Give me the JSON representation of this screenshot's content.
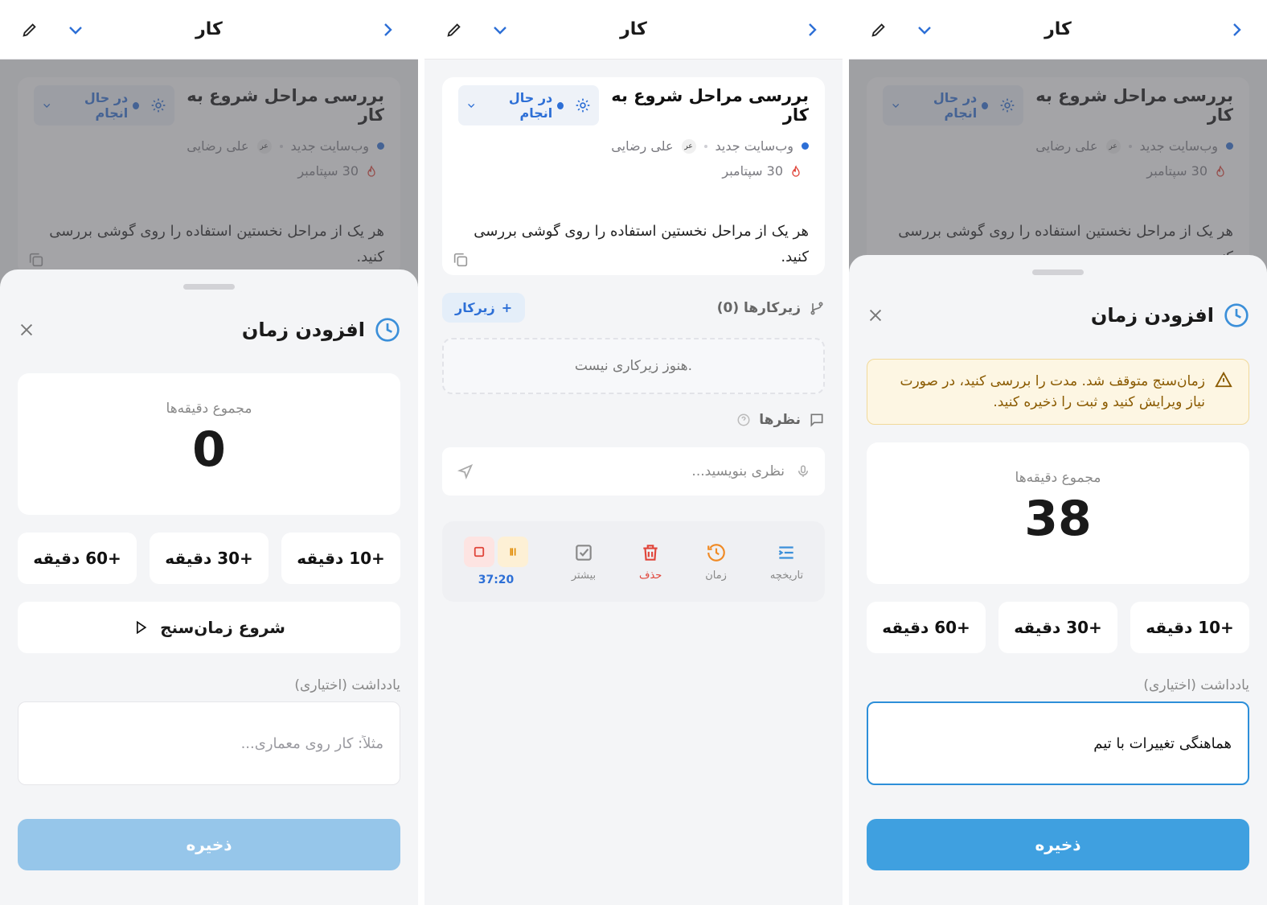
{
  "header": {
    "title": "کار"
  },
  "task": {
    "title": "بررسی مراحل شروع به کار",
    "status": "در حال انجام",
    "project": "وب‌سایت جدید",
    "assignee": "علی رضایی",
    "assignee_initials": "عر",
    "due": "30 سپتامبر",
    "description": "هر یک از مراحل نخستین استفاده را روی گوشی بررسی کنید."
  },
  "sheet": {
    "title": "افزودن زمان",
    "total_label": "مجموع دقیقه‌ها",
    "quick": [
      "+10 دقیقه",
      "+30 دقیقه",
      "+60 دقیقه"
    ],
    "start_timer": "شروع زمان‌سنج",
    "note_label": "یادداشت (اختیاری)",
    "note_placeholder": "مثلاً: کار روی معماری...",
    "save": "ذخیره"
  },
  "panel1": {
    "total": "0"
  },
  "panel3": {
    "total": "38",
    "note_value": "هماهنگی تغییرات با تیم",
    "warning": "زمان‌سنج متوقف شد. مدت را بررسی کنید، در صورت نیاز ویرایش کنید و ثبت را ذخیره کنید."
  },
  "panel2": {
    "subtasks_label": "زیرکارها (0)",
    "add_subtask": "زیرکار",
    "no_subtasks": "هنوز زیرکاری نیست.",
    "comments_label": "نظرها",
    "comment_placeholder": "نظری بنویسید...",
    "actions": [
      {
        "label": "تاریخچه",
        "icon": "history-list-icon",
        "color": "#3b8fd9"
      },
      {
        "label": "زمان",
        "icon": "clock-rewind-icon",
        "color": "#f08a24"
      },
      {
        "label": "حذف",
        "icon": "trash-icon",
        "color": "#e0453a"
      },
      {
        "label": "بیشتر",
        "icon": "checkbox-icon",
        "color": "#888888"
      }
    ],
    "timer": "37:20"
  },
  "colors": {
    "accent": "#2d6fd6",
    "save_disabled": "#96c6ea",
    "save_enabled": "#3fa0e0"
  }
}
